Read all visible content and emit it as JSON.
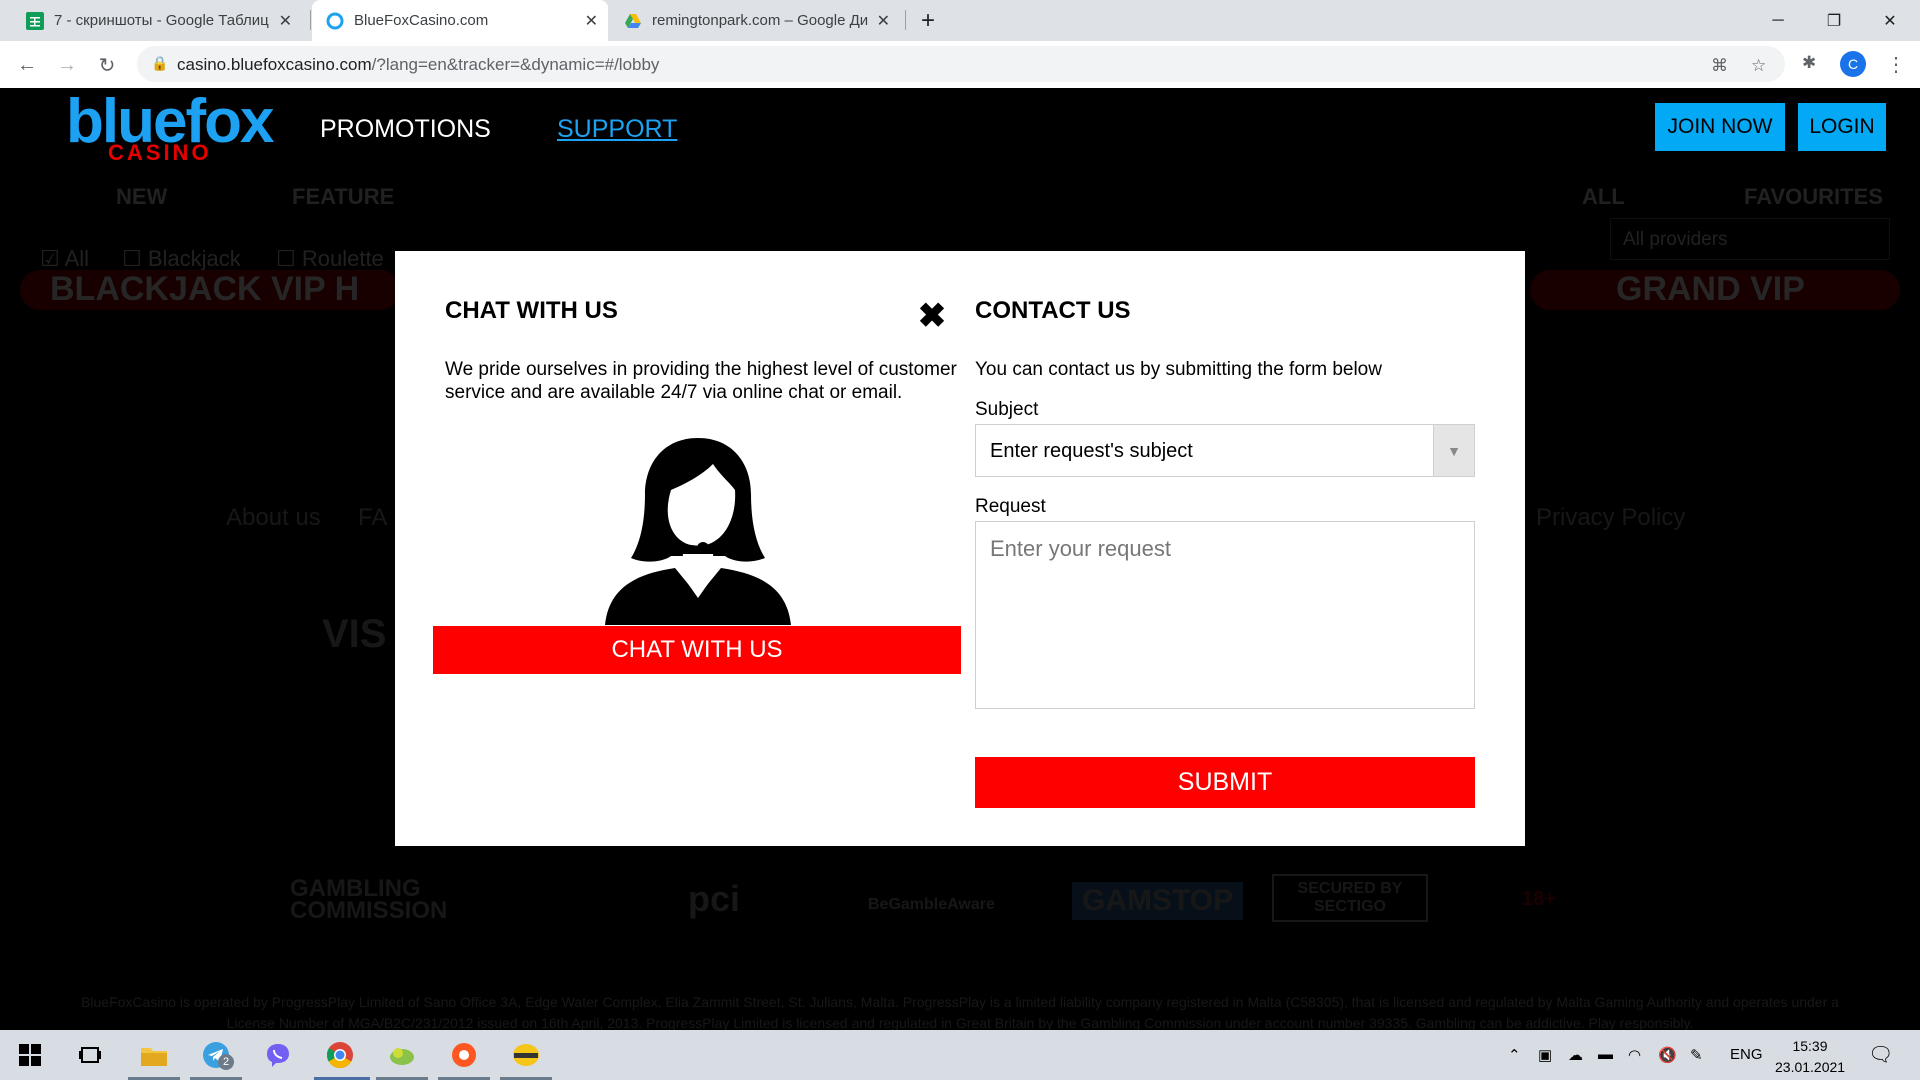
{
  "browser": {
    "tabs": [
      {
        "title": "7 - скриншоты - Google Таблиц",
        "favicon": "sheets-icon",
        "active": false
      },
      {
        "title": "BlueFoxCasino.com",
        "favicon": "bluefox-icon",
        "active": true
      },
      {
        "title": "remingtonpark.com – Google Ди",
        "favicon": "drive-icon",
        "active": false
      }
    ],
    "url_host": "casino.bluefoxcasino.com",
    "url_path": "/?lang=en&tracker=&dynamic=#/lobby",
    "profile_initial": "C"
  },
  "site": {
    "logo_main": "bluefox",
    "logo_sub": "CASINO",
    "nav": {
      "promotions": "PROMOTIONS",
      "support": "SUPPORT"
    },
    "join_label": "JOIN NOW",
    "login_label": "LOGIN",
    "categories": [
      "NEW",
      "FEATURE",
      "ALL",
      "FAVOURITES"
    ],
    "filters": [
      "All",
      "Blackjack",
      "Roulette"
    ],
    "providers_placeholder": "All providers",
    "banners": [
      "BLACKJACK VIP H",
      "GRAND VIP"
    ],
    "footer_links": [
      "About us",
      "FA",
      "Privacy Policy"
    ],
    "footer_logos": [
      "VIS",
      "GAMBLING COMMISSION",
      "pci",
      "BeGambleAware",
      "GAMSTOP",
      "SECURED BY SECTIGO",
      "18+"
    ],
    "legal": "BlueFoxCasino is operated by ProgressPlay Limited of Sano Office 3A, Edge Water Complex, Elia Zammit Street, St. Julians, Malta. ProgressPlay is a limited liability company registered in Malta (C58305), that is licensed and regulated by Malta Gaming Authority and operates under a License Number of MGA/B2C/231/2012 issued on 16th April, 2013. ProgressPlay Limited is licensed and regulated in Great Britain by the Gambling Commission under account number 39335. Gambling can be addictive. Play responsibly."
  },
  "modal": {
    "chat": {
      "heading": "CHAT WITH US",
      "text": "We pride ourselves in providing the highest level of customer service and are available 24/7 via online chat or email.",
      "button_label": "CHAT WITH US"
    },
    "contact": {
      "heading": "CONTACT US",
      "intro": "You can contact us by submitting the form below",
      "subject_label": "Subject",
      "subject_value": "Enter request's subject",
      "request_label": "Request",
      "request_placeholder": "Enter your request",
      "submit_label": "SUBMIT"
    }
  },
  "taskbar": {
    "language": "ENG",
    "time": "15:39",
    "date": "23.01.2021",
    "telegram_badge": "2"
  },
  "colors": {
    "accent_blue": "#03a9f4",
    "accent_red": "#ff0000"
  }
}
